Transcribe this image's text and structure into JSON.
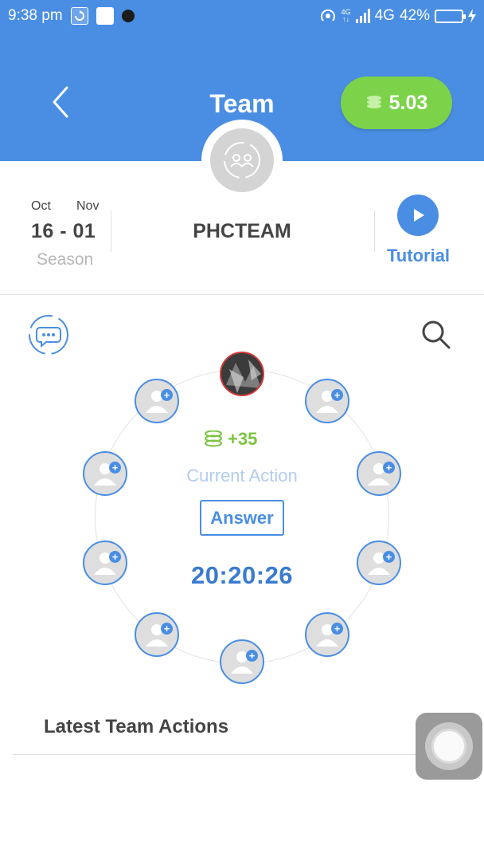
{
  "status_bar": {
    "time": "9:38 pm",
    "network_top": "4G",
    "network_bottom": "↑↓",
    "network": "4G",
    "battery": "42%",
    "battery_level": 0.42
  },
  "header": {
    "title": "Team",
    "balance": "5.03",
    "icons": {
      "back": "chevron-left-icon",
      "coins": "coin-stack-icon",
      "team": "team-group-icon"
    },
    "colors": {
      "header_bg": "#4a8ee3",
      "balance_bg": "#7cd34a"
    }
  },
  "season": {
    "month_start": "Oct",
    "month_end": "Nov",
    "date_range": "16 - 01",
    "label": "Season"
  },
  "team_name": "PHCTEAM",
  "tutorial": {
    "label": "Tutorial"
  },
  "action": {
    "reward": "+35",
    "label": "Current Action",
    "button": "Answer",
    "timer": "20:20:26"
  },
  "latest": {
    "heading": "Latest Team Actions"
  }
}
